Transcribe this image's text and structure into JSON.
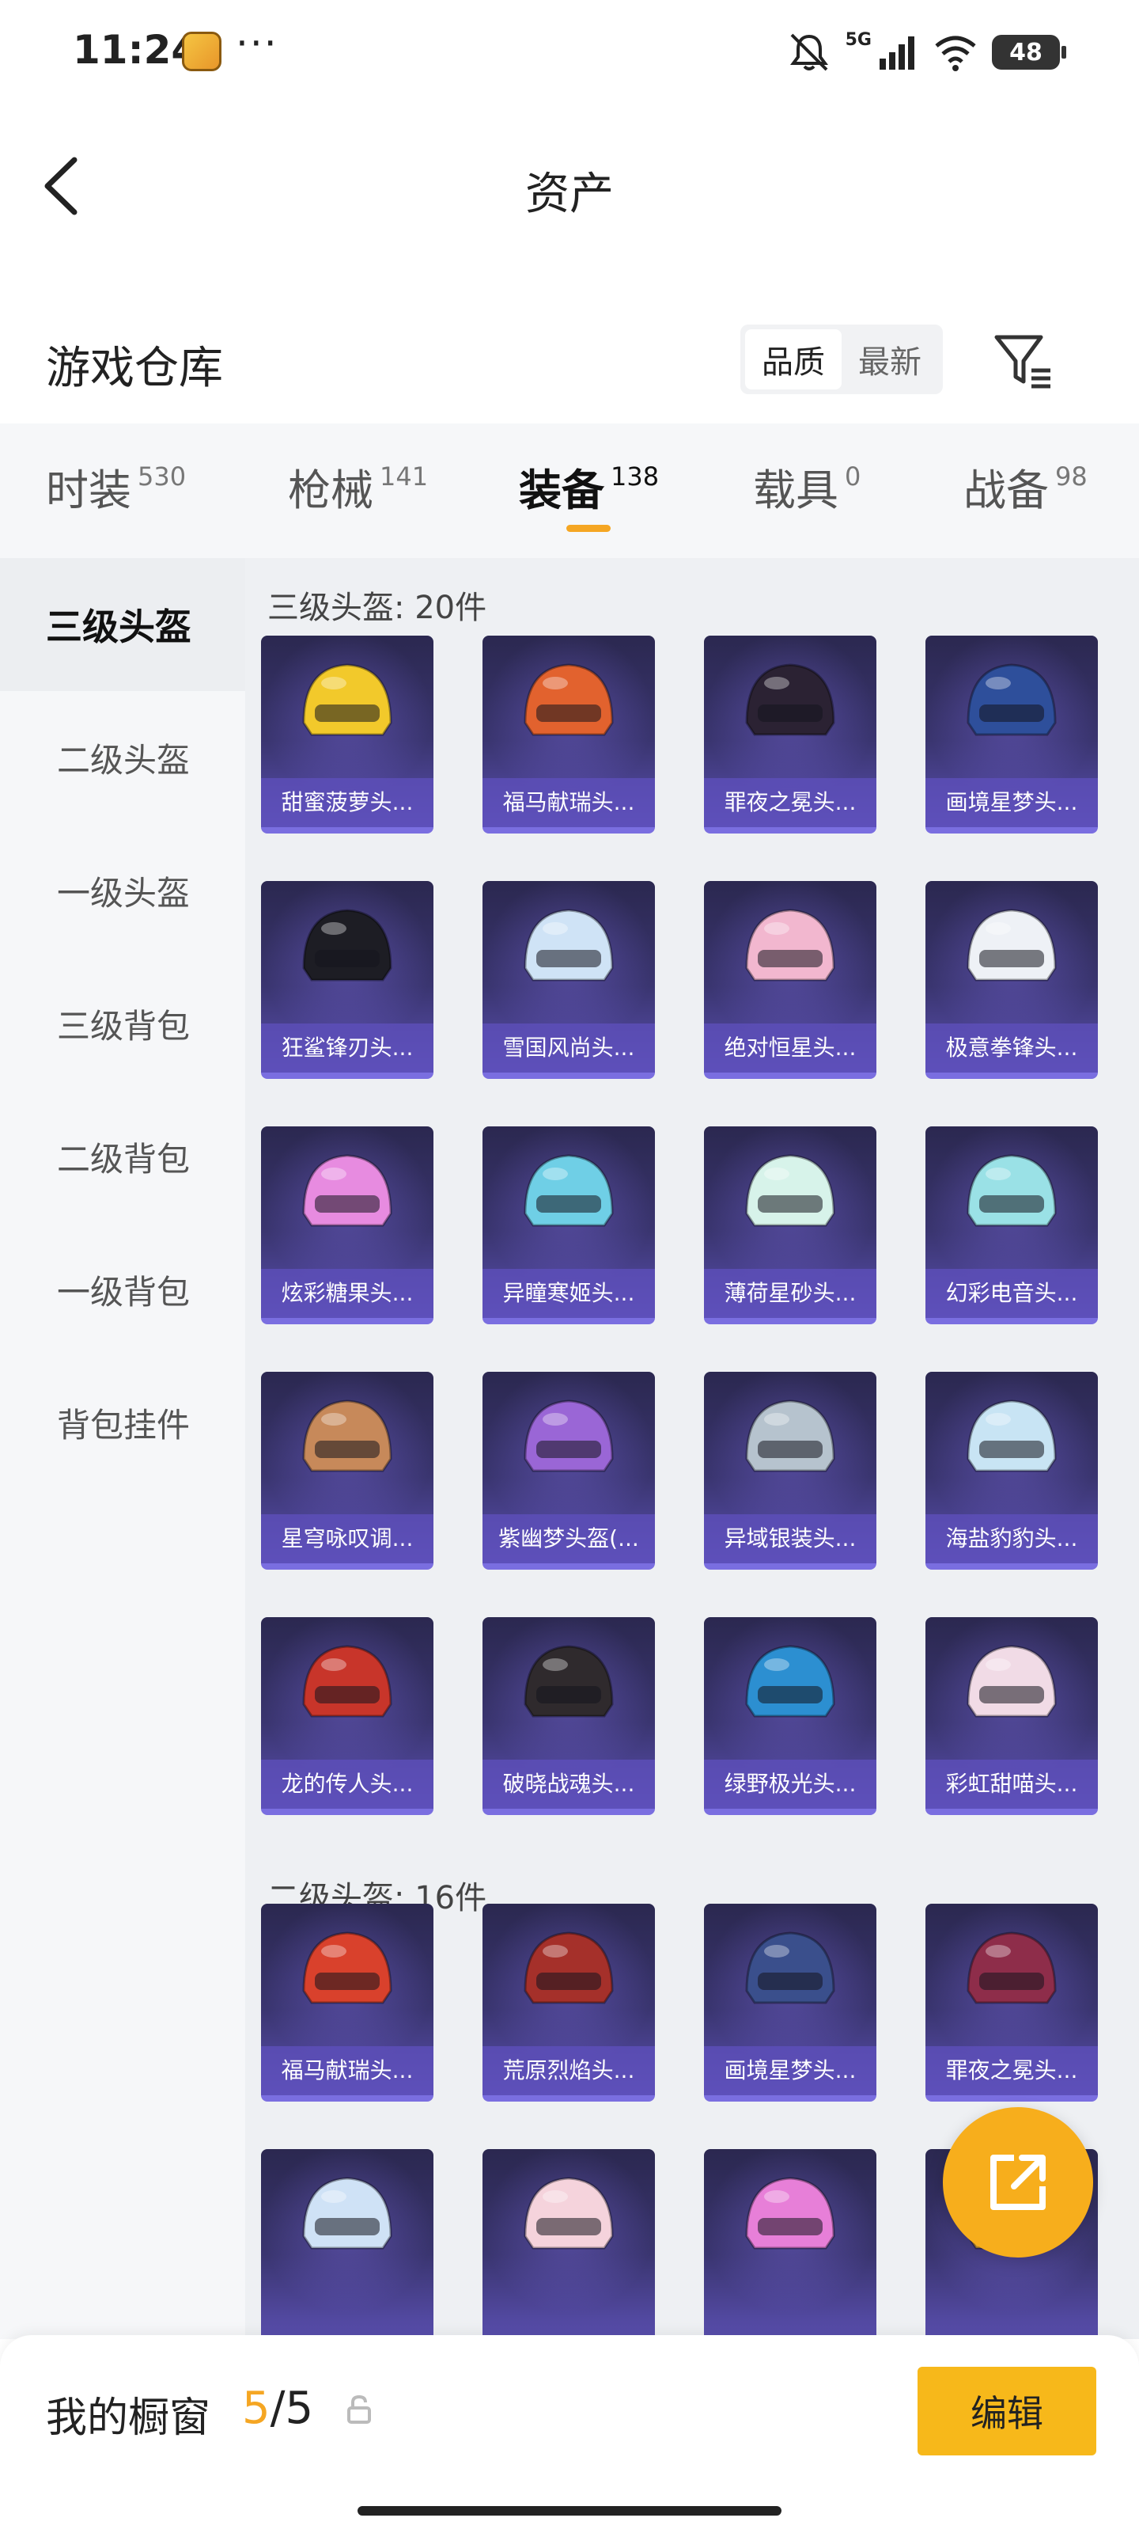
{
  "status_bar": {
    "time": "11:24",
    "more": "···",
    "network": "5G",
    "battery": "48",
    "icons": [
      "app-icon",
      "mute-icon",
      "signal-icon",
      "wifi-icon",
      "battery-icon"
    ]
  },
  "header": {
    "title": "资产",
    "back_icon": "chevron-left-icon"
  },
  "warehouse": {
    "title": "游戏仓库",
    "sort_options": [
      "品质",
      "最新"
    ],
    "selected_sort": "品质",
    "filter_icon": "filter-icon"
  },
  "tabs": [
    {
      "label": "时装",
      "count": "530"
    },
    {
      "label": "枪械",
      "count": "141"
    },
    {
      "label": "装备",
      "count": "138"
    },
    {
      "label": "载具",
      "count": "0"
    },
    {
      "label": "战备",
      "count": "98"
    }
  ],
  "active_tab": "装备",
  "sidebar": {
    "items": [
      "三级头盔",
      "二级头盔",
      "一级头盔",
      "三级背包",
      "二级背包",
      "一级背包",
      "背包挂件"
    ],
    "active": "三级头盔"
  },
  "sections": [
    {
      "title": "三级头盔: 20件",
      "items": [
        {
          "name": "甜蜜菠萝头...",
          "color": "#f2c92b"
        },
        {
          "name": "福马献瑞头...",
          "color": "#e2622e"
        },
        {
          "name": "罪夜之冕头...",
          "color": "#2b2233"
        },
        {
          "name": "画境星梦头...",
          "color": "#2e4f9b"
        },
        {
          "name": "狂鲨锋刃头...",
          "color": "#1d1d24"
        },
        {
          "name": "雪国风尚头...",
          "color": "#cfe3f6"
        },
        {
          "name": "绝对恒星头...",
          "color": "#f2b7cf"
        },
        {
          "name": "极意拳锋头...",
          "color": "#eef1f6"
        },
        {
          "name": "炫彩糖果头...",
          "color": "#e78be0"
        },
        {
          "name": "异瞳寒姬头...",
          "color": "#6fcfe6"
        },
        {
          "name": "薄荷星砂头...",
          "color": "#d7f3ea"
        },
        {
          "name": "幻彩电音头...",
          "color": "#9ae1e6"
        },
        {
          "name": "星穹咏叹调...",
          "color": "#c7895a"
        },
        {
          "name": "紫幽梦头盔(...",
          "color": "#9a66d6"
        },
        {
          "name": "异域银装头...",
          "color": "#b6c3ce"
        },
        {
          "name": "海盐豹豹头...",
          "color": "#c8e4f4"
        },
        {
          "name": "龙的传人头...",
          "color": "#c8352a"
        },
        {
          "name": "破晓战魂头...",
          "color": "#2f2a2d"
        },
        {
          "name": "绿野极光头...",
          "color": "#2c8fd1"
        },
        {
          "name": "彩虹甜喵头...",
          "color": "#f1dbe6"
        }
      ]
    },
    {
      "title": "二级头盔: 16件",
      "items": [
        {
          "name": "福马献瑞头...",
          "color": "#d9412c"
        },
        {
          "name": "荒原烈焰头...",
          "color": "#a5302a"
        },
        {
          "name": "画境星梦头...",
          "color": "#3a4f8c"
        },
        {
          "name": "罪夜之冕头...",
          "color": "#8e2d4a"
        },
        {
          "name": "",
          "color": "#cfe2f6"
        },
        {
          "name": "",
          "color": "#f5d3dc"
        },
        {
          "name": "",
          "color": "#e77fd8"
        },
        {
          "name": "",
          "color": "#f2b53a"
        }
      ]
    }
  ],
  "fab_icon": "share-external-icon",
  "bottom_bar": {
    "label": "我的橱窗",
    "used": "5",
    "separator": "/",
    "total": "5",
    "lock_icon": "lock-icon",
    "edit_label": "编辑"
  }
}
